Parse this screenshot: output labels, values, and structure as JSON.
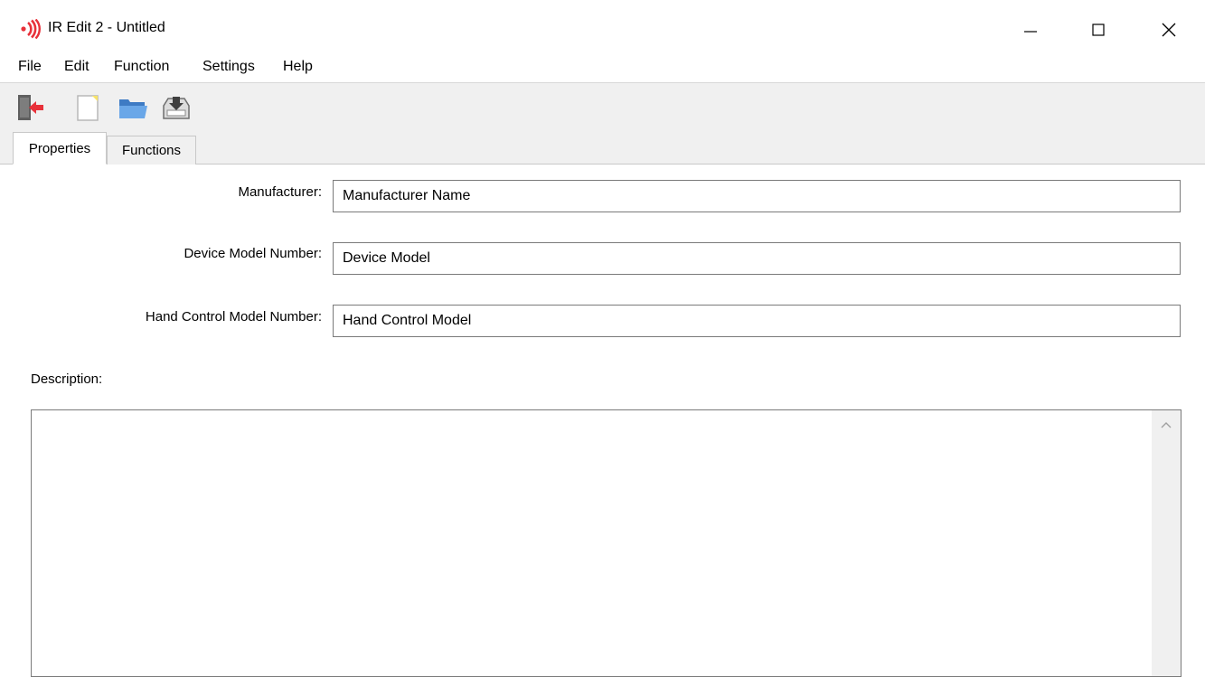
{
  "window": {
    "title": "IR Edit 2 - Untitled",
    "app_icon": "ir-signal-icon",
    "controls": [
      "minimize",
      "maximize",
      "close"
    ]
  },
  "menu": {
    "items": [
      {
        "label": "File"
      },
      {
        "label": "Edit"
      },
      {
        "label": "Function"
      },
      {
        "label": "Settings"
      },
      {
        "label": "Help"
      }
    ]
  },
  "toolbar": {
    "buttons": [
      "exit-icon",
      "new-file-icon",
      "open-folder-icon",
      "save-icon"
    ]
  },
  "tabs": {
    "items": [
      {
        "label": "Properties",
        "active": true
      },
      {
        "label": "Functions",
        "active": false
      }
    ]
  },
  "properties": {
    "manufacturer": {
      "label": "Manufacturer:",
      "value": "Manufacturer Name"
    },
    "device_model": {
      "label": "Device Model Number:",
      "value": "Device Model"
    },
    "hand_control_model": {
      "label": "Hand Control Model Number:",
      "value": "Hand Control Model"
    },
    "description": {
      "label": "Description:",
      "value": ""
    }
  },
  "colors": {
    "accent_red": "#e8313a",
    "chrome_gray": "#f0f0f0",
    "border_gray": "#7a7a7a"
  }
}
